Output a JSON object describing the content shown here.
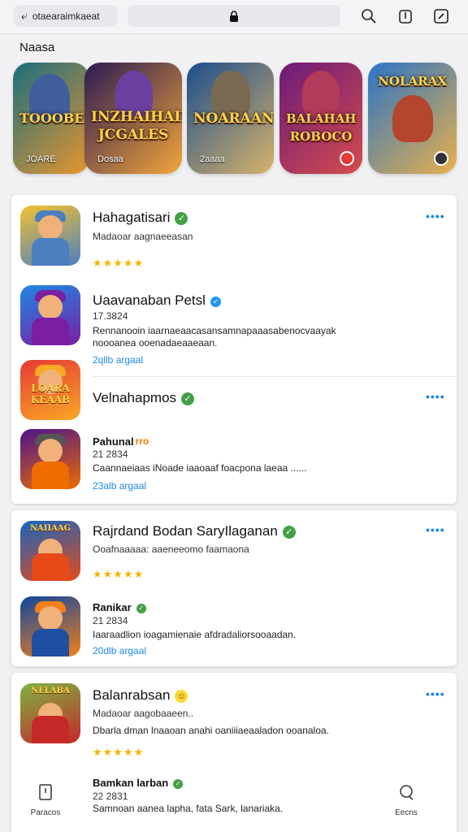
{
  "browser": {
    "url_text": "otaearaimkaeat",
    "back_icon": "back-arrow-icon",
    "lock_icon": "lock-icon",
    "tools": [
      "search-icon",
      "share-icon",
      "edit-icon"
    ]
  },
  "section": {
    "title": "Naasa"
  },
  "banners": [
    {
      "title": "TOOOBE",
      "sub": "JOARE",
      "colors": [
        "#1a6e7e",
        "#e8962d"
      ]
    },
    {
      "title": "INZHAIHAIN JCGALES",
      "sub": "Dosaa",
      "colors": [
        "#2a1a52",
        "#f3a53b"
      ]
    },
    {
      "title": "NOARAAN",
      "sub": "2aaaa",
      "colors": [
        "#1b4d8c",
        "#d7b26a"
      ]
    },
    {
      "title": "BALAHAH ROBOCO",
      "sub": "",
      "colors": [
        "#6a1b7a",
        "#d64b4b"
      ]
    },
    {
      "title": "NOLARAX",
      "sub": "",
      "colors": [
        "#2a74c8",
        "#e8b04a"
      ]
    }
  ],
  "cards": [
    {
      "entries": [
        {
          "name": "Hahagatisari",
          "verified": "green",
          "subline": "Madaoar aagnaeeasan",
          "stars": "★★★★★",
          "more": "••••",
          "icon_colors": [
            "#f1c232",
            "#4d7fc0"
          ]
        },
        {
          "name": "Uaavanaban Petsl",
          "verified": "blue",
          "subline": "17.3824",
          "desc_line1": "Rennanooin iaarnaeaacasansamnapaaasabenocvaayak",
          "desc_line2": "noooanea ooenadaeaaeaan.",
          "link": "2qllb argaal",
          "icon_colors": [
            "#1e88e5",
            "#7b1fa2"
          ]
        },
        {
          "name": "Velnahapmos",
          "verified": "green",
          "more": "••••",
          "icon_colors": [
            "#e53935",
            "#f9a825"
          ],
          "logo": "LOARA KEAAB"
        },
        {
          "name": "Pahunal",
          "verified": "orange",
          "verified_text": "rro",
          "subline": "21 2834",
          "desc_line1": "Caannaeiaas iNoade iaaoaaf foacpona laeaa ......",
          "link": "23alb argaal",
          "icon_colors": [
            "#4a148c",
            "#ef6c00"
          ]
        }
      ]
    },
    {
      "entries": [
        {
          "name": "Rajrdand Bodan SaryIlaganan",
          "verified": "green",
          "subline": "Ooafnaaaaa: aaeneeomo faamaona",
          "stars": "★★★★★",
          "more": "••••",
          "icon_colors": [
            "#1565c0",
            "#e64a19"
          ],
          "logo": "NAIIAAG"
        },
        {
          "name": "Ranikar",
          "verified": "green",
          "subline": "21 2834",
          "desc_line1": "Iaaraadlion ioagamienaie afdradaliorsooaadan.",
          "link": "20dlb argaal",
          "icon_colors": [
            "#0d47a1",
            "#f57f17"
          ]
        }
      ]
    },
    {
      "entries": [
        {
          "name": "Balanrabsan",
          "verified": "yellow",
          "subline": "Madaoar aagobaaeen..",
          "desc_line1": "Dbarla dman lnaaoan anahi oaniiiaeaaladon ooanaloa.",
          "stars": "★★★★★",
          "more": "••••",
          "icon_colors": [
            "#7cb342",
            "#c62828"
          ],
          "logo": "NELABA"
        },
        {
          "name": "Bamkan larban",
          "verified": "green",
          "subline": "22 2831",
          "desc_line1": "Samnoan aanea lapha, fata Sark, lanariaka."
        }
      ]
    }
  ],
  "bottom_bar": {
    "left": {
      "label": "Paracos",
      "icon": "document-icon"
    },
    "right": {
      "label": "Eecns",
      "icon": "search-icon"
    }
  }
}
